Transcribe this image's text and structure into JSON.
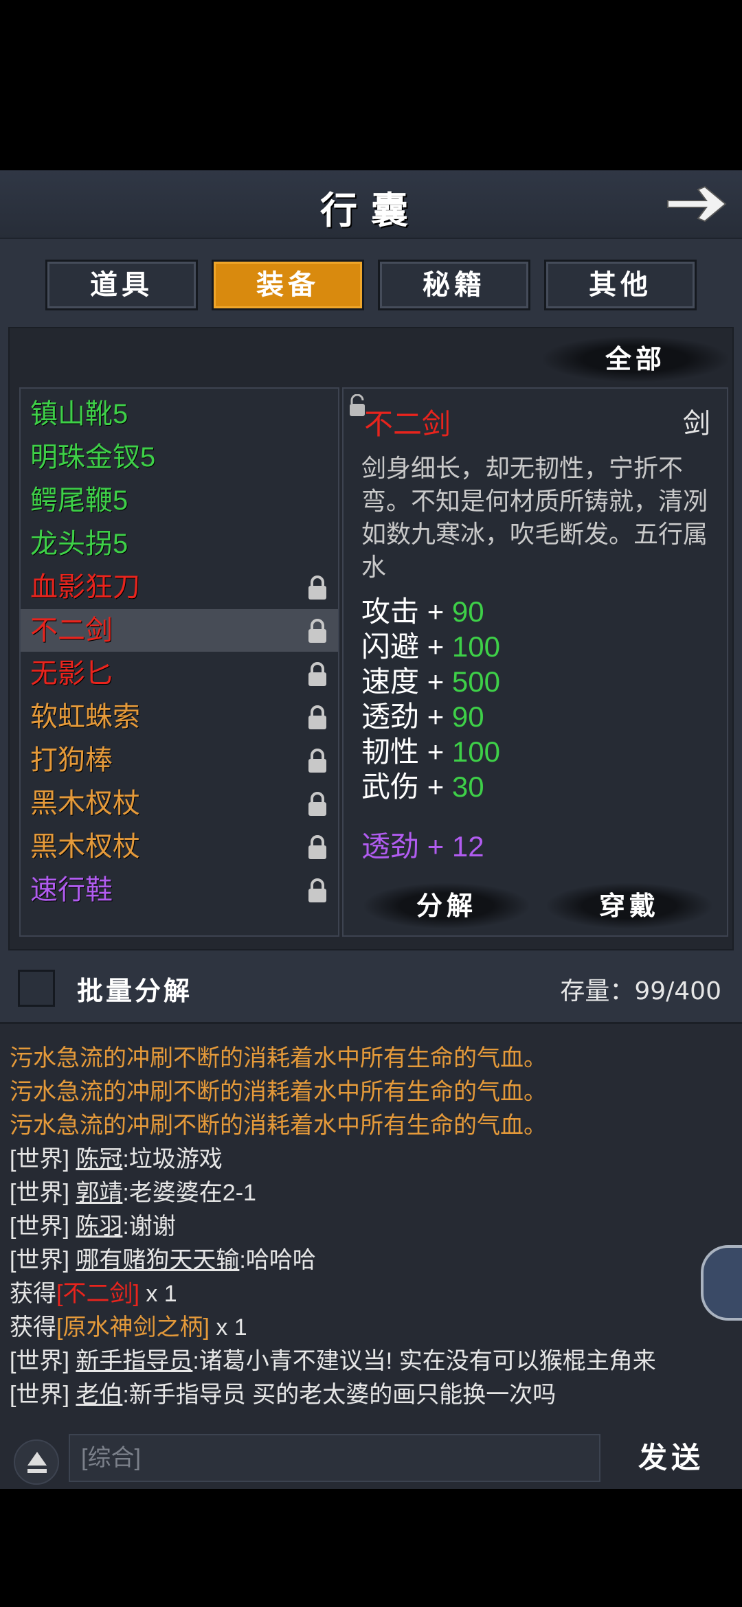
{
  "header": {
    "title": "行囊"
  },
  "tabs": [
    {
      "label": "道具",
      "active": false
    },
    {
      "label": "装备",
      "active": true
    },
    {
      "label": "秘籍",
      "active": false
    },
    {
      "label": "其他",
      "active": false
    }
  ],
  "filter_label": "全部",
  "items": [
    {
      "name": "镇山靴5",
      "color": "#3ed048",
      "locked": false
    },
    {
      "name": "明珠金钗5",
      "color": "#3ed048",
      "locked": false
    },
    {
      "name": "鳄尾鞭5",
      "color": "#3ed048",
      "locked": false
    },
    {
      "name": "龙头拐5",
      "color": "#3ed048",
      "locked": false
    },
    {
      "name": "血影狂刀",
      "color": "#e8241d",
      "locked": true
    },
    {
      "name": "不二剑",
      "color": "#e8241d",
      "locked": true,
      "selected": true
    },
    {
      "name": "无影匕",
      "color": "#e8241d",
      "locked": true
    },
    {
      "name": "软虹蛛索",
      "color": "#e59a3a",
      "locked": true
    },
    {
      "name": "打狗棒",
      "color": "#e59a3a",
      "locked": true
    },
    {
      "name": "黑木杈杖",
      "color": "#e59a3a",
      "locked": true
    },
    {
      "name": "黑木杈杖",
      "color": "#e59a3a",
      "locked": true
    },
    {
      "name": "速行鞋",
      "color": "#b15cf0",
      "locked": true
    }
  ],
  "detail": {
    "name": "不二剑",
    "type": "剑",
    "description": "剑身细长，却无韧性，宁折不弯。不知是何材质所铸就，清冽如数九寒冰，吹毛断发。五行属水",
    "stats": [
      {
        "label": "攻击",
        "plus": "+",
        "value": "90"
      },
      {
        "label": "闪避",
        "plus": "+",
        "value": "100"
      },
      {
        "label": "速度",
        "plus": "+",
        "value": "500"
      },
      {
        "label": "透劲",
        "plus": "+",
        "value": "90"
      },
      {
        "label": "韧性",
        "plus": "+",
        "value": "100"
      },
      {
        "label": "武伤",
        "plus": "+",
        "value": "30"
      }
    ],
    "extra_stat": {
      "label": "透劲",
      "plus": "+",
      "value": "12"
    },
    "decompose_label": "分解",
    "equip_label": "穿戴"
  },
  "batch": {
    "label": "批量分解",
    "checked": false
  },
  "capacity": "存量：99/400",
  "chat": {
    "messages": [
      {
        "kind": "sys",
        "text": "污水急流的冲刷不断的消耗着水中所有生命的气血。"
      },
      {
        "kind": "sys",
        "text": "污水急流的冲刷不断的消耗着水中所有生命的气血。"
      },
      {
        "kind": "sys",
        "text": "污水急流的冲刷不断的消耗着水中所有生命的气血。"
      },
      {
        "kind": "world",
        "channel": "[世界]",
        "nick": "陈冠",
        "text": ":垃圾游戏"
      },
      {
        "kind": "world",
        "channel": "[世界]",
        "nick": "郭靖",
        "text": ":老婆婆在2-1"
      },
      {
        "kind": "world",
        "channel": "[世界]",
        "nick": "陈羽",
        "text": ":谢谢"
      },
      {
        "kind": "world",
        "channel": "[世界]",
        "nick": "哪有赌狗天天输",
        "text": ":哈哈哈"
      },
      {
        "kind": "got",
        "prefix": "获得",
        "item": "[不二剑]",
        "item_color": "red",
        "count": " x 1"
      },
      {
        "kind": "got",
        "prefix": "获得",
        "item": "[原水神剑之柄]",
        "item_color": "orange",
        "count": " x 1"
      },
      {
        "kind": "world",
        "channel": "[世界]",
        "nick": "新手指导员",
        "text": ":诸葛小青不建议当! 实在没有可以猴棍主角来"
      },
      {
        "kind": "world",
        "channel": "[世界]",
        "nick": "老伯",
        "text": ":新手指导员 买的老太婆的画只能换一次吗"
      }
    ],
    "input_placeholder": "[综合]",
    "send_label": "发送"
  }
}
